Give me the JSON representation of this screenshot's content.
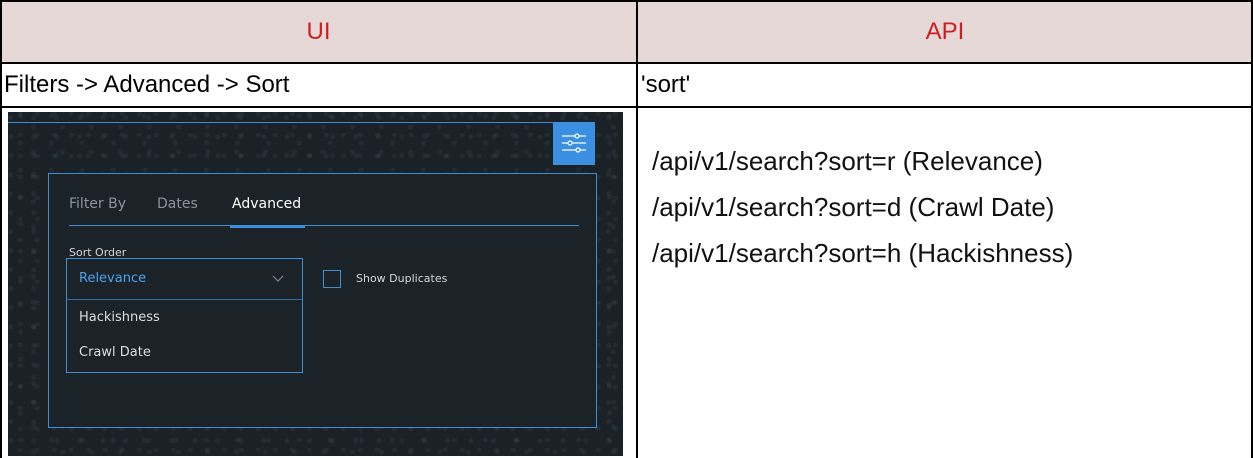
{
  "table": {
    "headers": {
      "left": "UI",
      "right": "API"
    },
    "row1": {
      "left": "Filters -> Advanced -> Sort",
      "right": "'sort'"
    },
    "row2": {
      "api_lines": [
        "/api/v1/search?sort=r (Relevance)",
        "/api/v1/search?sort=d (Crawl Date)",
        "/api/v1/search?sort=h (Hackishness)"
      ]
    }
  },
  "screenshot": {
    "tabs": [
      "Filter By",
      "Dates",
      "Advanced"
    ],
    "active_tab": "Advanced",
    "sort_label": "Sort Order",
    "select_value": "Relevance",
    "options": [
      "Hackishness",
      "Crawl Date"
    ],
    "checkbox_label": "Show Duplicates",
    "checkbox_checked": false,
    "colors": {
      "accent": "#3a8fe0",
      "background": "#1a2127",
      "header_text": "#cc1f1f",
      "header_bg": "#e6d8d6"
    },
    "icons": {
      "filter_button": "sliders-icon",
      "select_arrow": "chevron-down-icon"
    }
  }
}
